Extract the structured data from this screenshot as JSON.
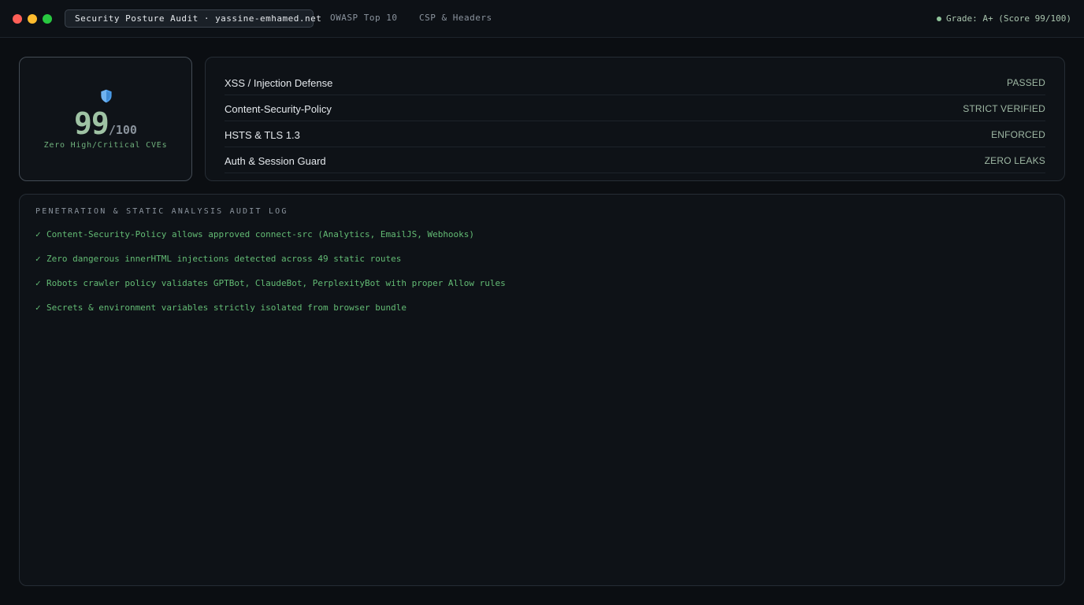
{
  "window": {
    "tabs": [
      {
        "label": "Security Posture Audit · yassine-emhamed.net"
      },
      {
        "label": "OWASP Top 10"
      },
      {
        "label": "CSP & Headers"
      }
    ],
    "grade_text": "Grade: A+ (Score 99/100)"
  },
  "score_card": {
    "score": "99",
    "denominator": "/100",
    "subtitle": "Zero High/Critical CVEs",
    "icon": "shield-icon"
  },
  "checks": [
    {
      "label": "XSS / Injection Defense",
      "status": "PASSED"
    },
    {
      "label": "Content-Security-Policy",
      "status": "STRICT VERIFIED"
    },
    {
      "label": "HSTS & TLS 1.3",
      "status": "ENFORCED"
    },
    {
      "label": "Auth & Session Guard",
      "status": "ZERO LEAKS"
    }
  ],
  "audit_log": {
    "title": "PENETRATION & STATIC ANALYSIS AUDIT LOG",
    "check_glyph": "✓",
    "entries": [
      "Content-Security-Policy allows approved connect-src (Analytics, EmailJS, Webhooks)",
      "Zero dangerous innerHTML injections detected across 49 static routes",
      "Robots crawler policy validates GPTBot, ClaudeBot, PerplexityBot with proper Allow rules",
      "Secrets & environment variables strictly isolated from browser bundle"
    ]
  },
  "colors": {
    "background": "#0b0e12",
    "accent_green": "#63bb74",
    "score_green": "#9fc3a4",
    "shield_blue": "#4a9be8"
  }
}
